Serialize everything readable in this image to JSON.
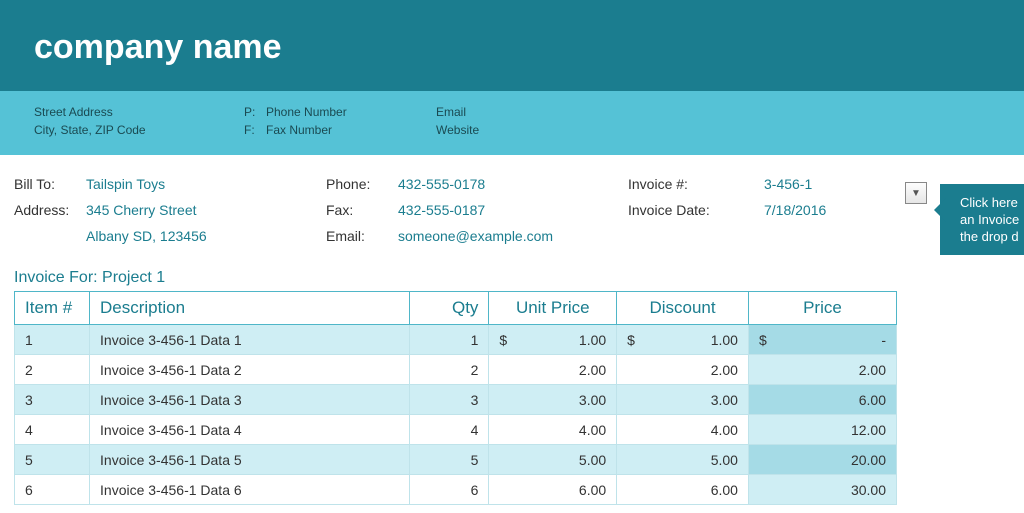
{
  "header": {
    "company_name": "company name",
    "street": "Street Address",
    "csz": "City, State, ZIP Code",
    "p_label": "P:",
    "f_label": "F:",
    "phone": "Phone Number",
    "fax": "Fax Number",
    "email": "Email",
    "website": "Website"
  },
  "bill": {
    "bill_to_label": "Bill To:",
    "address_label": "Address:",
    "phone_label": "Phone:",
    "fax_label": "Fax:",
    "email_label": "Email:",
    "invno_label": "Invoice #:",
    "invdate_label": "Invoice Date:",
    "name": "Tailspin Toys",
    "addr1": "345 Cherry Street",
    "addr2": "Albany SD, 123456",
    "phone": "432-555-0178",
    "fax": "432-555-0187",
    "email": "someone@example.com",
    "invno": "3-456-1",
    "invdate": "7/18/2016"
  },
  "invoice_for": "Invoice For: Project 1",
  "columns": {
    "item": "Item #",
    "desc": "Description",
    "qty": "Qty",
    "unit": "Unit Price",
    "disc": "Discount",
    "price": "Price"
  },
  "rows": [
    {
      "item": "1",
      "desc": "Invoice 3-456-1 Data 1",
      "qty": "1",
      "unit_sym": "$",
      "unit": "1.00",
      "disc_sym": "$",
      "disc": "1.00",
      "price_sym": "$",
      "price": "-"
    },
    {
      "item": "2",
      "desc": "Invoice 3-456-1 Data 2",
      "qty": "2",
      "unit_sym": "",
      "unit": "2.00",
      "disc_sym": "",
      "disc": "2.00",
      "price_sym": "",
      "price": "2.00"
    },
    {
      "item": "3",
      "desc": "Invoice 3-456-1 Data 3",
      "qty": "3",
      "unit_sym": "",
      "unit": "3.00",
      "disc_sym": "",
      "disc": "3.00",
      "price_sym": "",
      "price": "6.00"
    },
    {
      "item": "4",
      "desc": "Invoice 3-456-1 Data 4",
      "qty": "4",
      "unit_sym": "",
      "unit": "4.00",
      "disc_sym": "",
      "disc": "4.00",
      "price_sym": "",
      "price": "12.00"
    },
    {
      "item": "5",
      "desc": "Invoice 3-456-1 Data 5",
      "qty": "5",
      "unit_sym": "",
      "unit": "5.00",
      "disc_sym": "",
      "disc": "5.00",
      "price_sym": "",
      "price": "20.00"
    },
    {
      "item": "6",
      "desc": "Invoice 3-456-1 Data 6",
      "qty": "6",
      "unit_sym": "",
      "unit": "6.00",
      "disc_sym": "",
      "disc": "6.00",
      "price_sym": "",
      "price": "30.00"
    }
  ],
  "tooltip": {
    "line1": "Click here",
    "line2": "an Invoice",
    "line3": "the drop d"
  }
}
